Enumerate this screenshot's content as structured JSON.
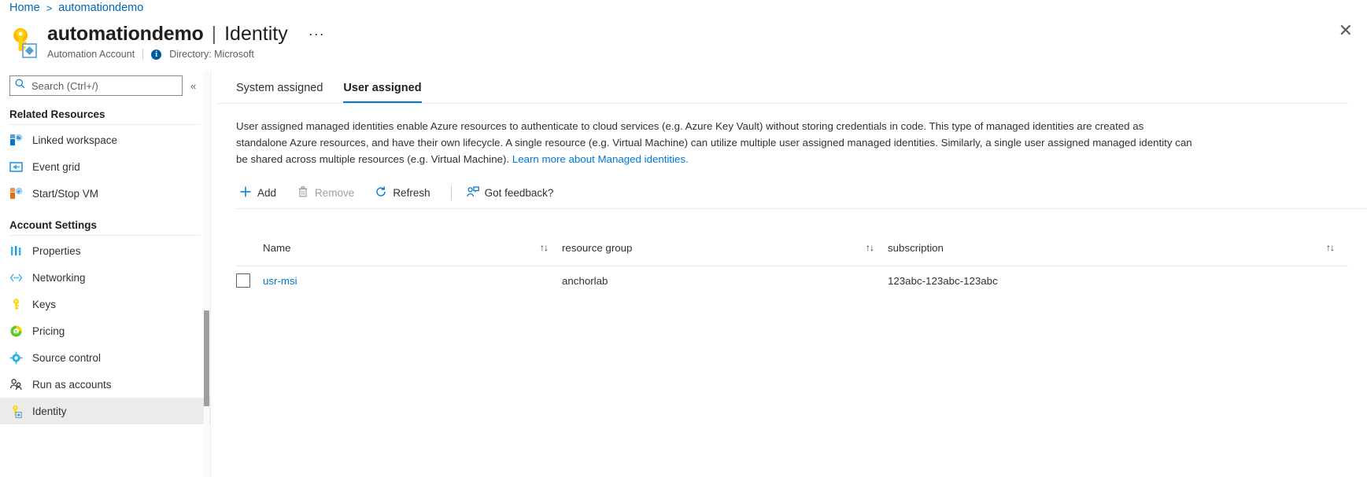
{
  "breadcrumb": {
    "home": "Home",
    "separator": ">",
    "current": "automationdemo"
  },
  "header": {
    "resource_name": "automationdemo",
    "pipe": "|",
    "page_name": "Identity",
    "more_label": "···",
    "resource_type": "Automation Account",
    "info_glyph": "i",
    "directory": "Directory: Microsoft",
    "close_label": "✕",
    "resource_icon": "automation-account-key-icon"
  },
  "sidebar": {
    "search": {
      "placeholder": "Search (Ctrl+/)",
      "value": "",
      "icon": "search-icon"
    },
    "collapse_label": "«",
    "groups": [
      {
        "title": "Related Resources",
        "items": [
          {
            "label": "Linked workspace",
            "icon": "linked-workspace-icon",
            "selected": false
          },
          {
            "label": "Event grid",
            "icon": "event-grid-icon",
            "selected": false
          },
          {
            "label": "Start/Stop VM",
            "icon": "start-stop-vm-icon",
            "selected": false
          }
        ]
      },
      {
        "title": "Account Settings",
        "items": [
          {
            "label": "Properties",
            "icon": "properties-icon",
            "selected": false
          },
          {
            "label": "Networking",
            "icon": "networking-icon",
            "selected": false
          },
          {
            "label": "Keys",
            "icon": "keys-icon",
            "selected": false
          },
          {
            "label": "Pricing",
            "icon": "pricing-icon",
            "selected": false
          },
          {
            "label": "Source control",
            "icon": "source-control-icon",
            "selected": false
          },
          {
            "label": "Run as accounts",
            "icon": "run-as-accounts-icon",
            "selected": false
          },
          {
            "label": "Identity",
            "icon": "identity-icon",
            "selected": true
          }
        ]
      }
    ]
  },
  "main": {
    "tabs": [
      {
        "label": "System assigned",
        "active": false
      },
      {
        "label": "User assigned",
        "active": true
      }
    ],
    "description": {
      "text_before_link": "User assigned managed identities enable Azure resources to authenticate to cloud services (e.g. Azure Key Vault) without storing credentials in code. This type of managed identities are created as standalone Azure resources, and have their own lifecycle. A single resource (e.g. Virtual Machine) can utilize multiple user assigned managed identities. Similarly, a single user assigned managed identity can be shared across multiple resources (e.g. Virtual Machine). ",
      "link_text": "Learn more about Managed identities.",
      "text_after_link": ""
    },
    "commands": [
      {
        "label": "Add",
        "icon": "plus-icon",
        "disabled": false
      },
      {
        "label": "Remove",
        "icon": "trash-icon",
        "disabled": true
      },
      {
        "label": "Refresh",
        "icon": "refresh-icon",
        "disabled": false
      },
      {
        "label": "Got feedback?",
        "icon": "feedback-person-icon",
        "disabled": false
      }
    ],
    "table": {
      "columns": [
        {
          "label": "Name",
          "sort_icon": "↑↓"
        },
        {
          "label": "resource group",
          "sort_icon": "↑↓"
        },
        {
          "label": "subscription",
          "sort_icon": "↑↓"
        }
      ],
      "rows": [
        {
          "name": "usr-msi",
          "resource_group": "anchorlab",
          "subscription": "123abc-123abc-123abc",
          "checked": false
        }
      ]
    }
  },
  "colors": {
    "accent": "#0078d4",
    "link": "#0067b8",
    "selected_row_bg": "#edebe9",
    "border": "#edebe9"
  }
}
